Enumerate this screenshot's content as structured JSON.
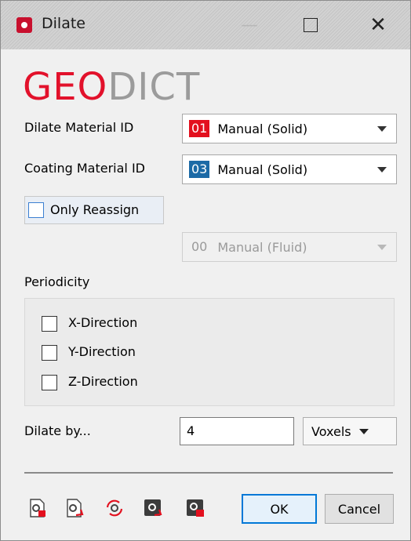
{
  "window": {
    "title": "Dilate"
  },
  "logo": {
    "part1": "GEO",
    "part2": "DICT"
  },
  "dilate_material": {
    "label": "Dilate Material ID",
    "id": "01",
    "value": "Manual (Solid)",
    "color": "#e3101e"
  },
  "coating_material": {
    "label": "Coating Material ID",
    "id": "03",
    "value": "Manual (Solid)",
    "color": "#1c6aa6"
  },
  "only_reassign": {
    "label": "Only Reassign",
    "checked": false
  },
  "reassign_material": {
    "id": "00",
    "value": "Manual (Fluid)",
    "enabled": false
  },
  "periodicity": {
    "label": "Periodicity",
    "options": [
      {
        "label": "X-Direction",
        "checked": false
      },
      {
        "label": "Y-Direction",
        "checked": false
      },
      {
        "label": "Z-Direction",
        "checked": false
      }
    ]
  },
  "dilate_by": {
    "label": "Dilate by...",
    "value": "4",
    "unit": "Voxels"
  },
  "toolbar": {
    "icons": [
      "save-settings-icon",
      "load-settings-icon",
      "reset-settings-icon",
      "macro-record-icon",
      "macro-save-icon"
    ]
  },
  "buttons": {
    "ok": "OK",
    "cancel": "Cancel"
  }
}
